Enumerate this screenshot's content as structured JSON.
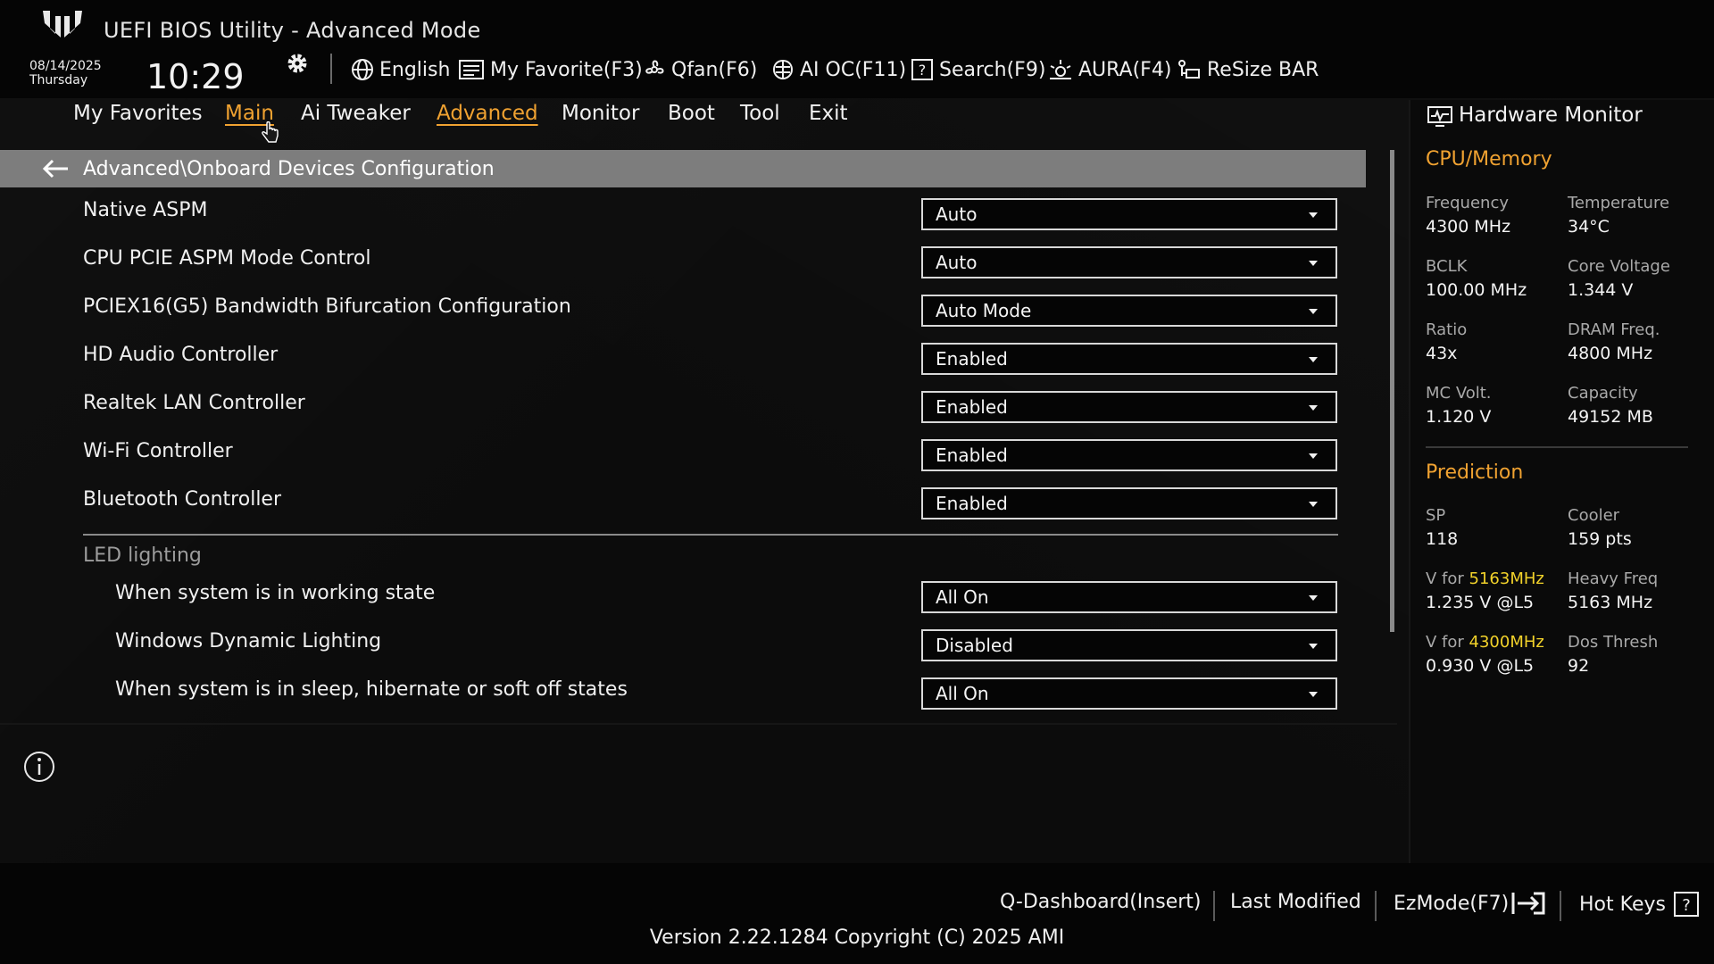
{
  "app": {
    "title": "UEFI BIOS Utility - Advanced Mode"
  },
  "datetime": {
    "date": "08/14/2025",
    "day": "Thursday",
    "time": "10:29"
  },
  "toolbar": {
    "language": "English",
    "my_favorite": "My Favorite(F3)",
    "qfan": "Qfan(F6)",
    "ai_oc": "AI OC(F11)",
    "search": "Search(F9)",
    "aura": "AURA(F4)",
    "resize_bar": "ReSize BAR"
  },
  "menu": {
    "active": "Advanced",
    "items": [
      "My Favorites",
      "Main",
      "Ai Tweaker",
      "Advanced",
      "Monitor",
      "Boot",
      "Tool",
      "Exit"
    ]
  },
  "breadcrumb": "Advanced\\Onboard Devices Configuration",
  "settings": [
    {
      "label": "Native ASPM",
      "value": "Auto"
    },
    {
      "label": "CPU PCIE ASPM Mode Control",
      "value": "Auto"
    },
    {
      "label": "PCIEX16(G5) Bandwidth Bifurcation Configuration",
      "value": "Auto Mode"
    },
    {
      "label": "HD Audio Controller",
      "value": "Enabled"
    },
    {
      "label": "Realtek LAN Controller",
      "value": "Enabled"
    },
    {
      "label": "Wi-Fi Controller",
      "value": "Enabled"
    },
    {
      "label": "Bluetooth Controller",
      "value": "Enabled"
    }
  ],
  "led_section": {
    "title": "LED lighting",
    "settings": [
      {
        "label": "When system is in working state",
        "value": "All On"
      },
      {
        "label": "Windows Dynamic Lighting",
        "value": "Disabled"
      },
      {
        "label": "When system is in sleep, hibernate or soft off states",
        "value": "All On"
      }
    ]
  },
  "hardware_monitor": {
    "title": "Hardware Monitor",
    "cpu_memory": {
      "title": "CPU/Memory",
      "items": [
        {
          "label": "Frequency",
          "value": "4300 MHz"
        },
        {
          "label": "Temperature",
          "value": "34°C"
        },
        {
          "label": "BCLK",
          "value": "100.00 MHz"
        },
        {
          "label": "Core Voltage",
          "value": "1.344 V"
        },
        {
          "label": "Ratio",
          "value": "43x"
        },
        {
          "label": "DRAM Freq.",
          "value": "4800 MHz"
        },
        {
          "label": "MC Volt.",
          "value": "1.120 V"
        },
        {
          "label": "Capacity",
          "value": "49152 MB"
        }
      ]
    },
    "prediction": {
      "title": "Prediction",
      "sp_label": "SP",
      "sp_value": "118",
      "cooler_label": "Cooler",
      "cooler_value": "159 pts",
      "v_for_label": "V for ",
      "v_for_1_freq": "5163MHz",
      "v_for_1_value": "1.235 V @L5",
      "heavy_freq_label": "Heavy Freq",
      "heavy_freq_value": "5163 MHz",
      "v_for_2_freq": "4300MHz",
      "v_for_2_value": "0.930 V @L5",
      "dos_thresh_label": "Dos Thresh",
      "dos_thresh_value": "92"
    }
  },
  "footer": {
    "q_dashboard": "Q-Dashboard(Insert)",
    "last_modified": "Last Modified",
    "ez_mode": "EzMode(F7)",
    "hot_keys": "Hot Keys",
    "version": "Version 2.22.1284 Copyright (C) 2025 AMI"
  },
  "colors": {
    "accent": "#f0a231",
    "highlight": "#f2d22a",
    "breadcrumb_bg": "#7d7d7d",
    "background": "#0c0c0c"
  }
}
